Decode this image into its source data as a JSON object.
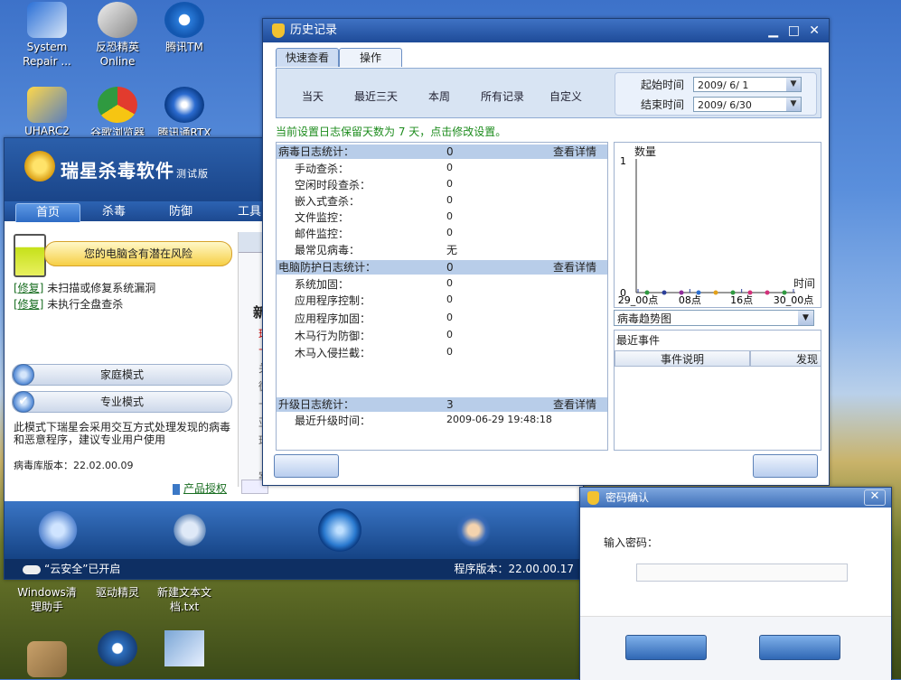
{
  "desktop": {
    "icons": [
      {
        "label": "System\nRepair ..."
      },
      {
        "label": "反恐精英\nOnline"
      },
      {
        "label": "腾讯TM"
      },
      {
        "label": "UHARC2"
      },
      {
        "label": "谷歌浏览器"
      },
      {
        "label": "腾讯通RTX"
      },
      {
        "label": "Windows清\n理助手"
      },
      {
        "label": "驱动精灵"
      },
      {
        "label": "新建文本文\n档.txt"
      }
    ]
  },
  "rising": {
    "brand": "瑞星杀毒软件",
    "edition": "测试版",
    "nav": [
      "首页",
      "杀毒",
      "防御",
      "工具"
    ],
    "risk": "您的电脑含有潜在风险",
    "fixes": [
      {
        "link": "[修复]",
        "text": "未扫描或修复系统漏洞"
      },
      {
        "link": "[修复]",
        "text": "未执行全盘查杀"
      }
    ],
    "modes": [
      {
        "label": "家庭模式",
        "selected": false
      },
      {
        "label": "专业模式",
        "selected": true
      }
    ],
    "mode_desc": "此模式下瑞星会采用交互方式处理发现的病毒和恶意程序，建议专业用户使用",
    "virus_db": "病毒库版本：22.02.00.09",
    "auth_link": "产品授权",
    "partial_text": [
      "新",
      "瑞",
      "十",
      "关",
      "微",
      "卡",
      "亚",
      "瑞",
      "案"
    ],
    "cloud": "“云安全”已开启",
    "program_version": "程序版本：22.00.00.17"
  },
  "history": {
    "title": "历史记录",
    "tabs": [
      "快速查看",
      "操作"
    ],
    "quick": [
      "当天",
      "最近三天",
      "本周",
      "所有记录",
      "自定义"
    ],
    "start_label": "起始时间",
    "start_value": "2009/ 6/ 1",
    "end_label": "结束时间",
    "end_value": "2009/ 6/30",
    "tip": "当前设置日志保留天数为 7 天，点击修改设置。",
    "sections": [
      {
        "title": "病毒日志统计：",
        "count": "0",
        "link": "查看详情",
        "rows": [
          {
            "label": "手动查杀：",
            "value": "0"
          },
          {
            "label": "空闲时段查杀：",
            "value": "0"
          },
          {
            "label": "嵌入式查杀：",
            "value": "0"
          },
          {
            "label": "文件监控：",
            "value": "0"
          },
          {
            "label": "邮件监控：",
            "value": "0"
          },
          {
            "label": "最常见病毒：",
            "value": "无"
          }
        ]
      },
      {
        "title": "电脑防护日志统计：",
        "count": "0",
        "link": "查看详情",
        "rows": [
          {
            "label": "系统加固：",
            "value": "0"
          },
          {
            "label": "应用程序控制：",
            "value": "0"
          },
          {
            "label": "应用程序加固：",
            "value": "0"
          },
          {
            "label": "木马行为防御：",
            "value": "0"
          },
          {
            "label": "木马入侵拦截：",
            "value": "0"
          }
        ]
      },
      {
        "title": "升级日志统计：",
        "count": "3",
        "link": "查看详情",
        "rows": [
          {
            "label": "最近升级时间：",
            "value": "2009-06-29 19:48:18"
          }
        ]
      }
    ],
    "trend_select": "病毒趋势图",
    "events_title": "最近事件",
    "events_cols": [
      "事件说明",
      "发现"
    ]
  },
  "chart_data": {
    "type": "line",
    "ylabel": "数量",
    "xlabel": "时间",
    "ylim": [
      0,
      1
    ],
    "y_ticks": [
      "0",
      "1"
    ],
    "x_ticks": [
      "29_00点",
      "08点",
      "16点",
      "30_00点"
    ],
    "point_colors": [
      "#2f9a40",
      "#2c3f9a",
      "#8e2c9a",
      "#2c6fd0",
      "#e3a11a",
      "#2f9a40",
      "#d3307a",
      "#d3307a",
      "#2f9a40"
    ],
    "values": [
      0,
      0,
      0,
      0,
      0,
      0,
      0,
      0,
      0
    ]
  },
  "password": {
    "title": "密码确认",
    "label": "输入密码："
  }
}
